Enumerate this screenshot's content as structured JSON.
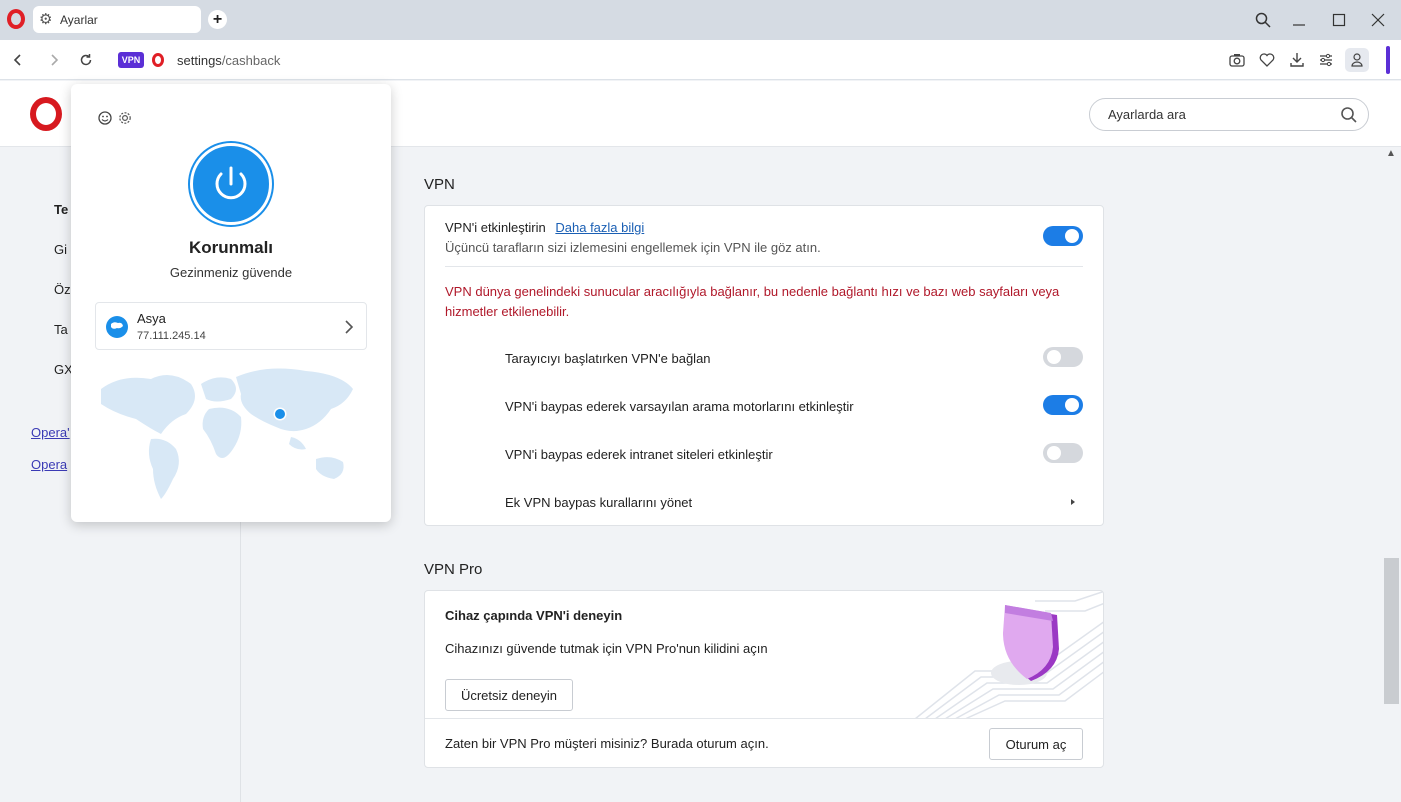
{
  "tab": {
    "title": "Ayarlar"
  },
  "address": {
    "vpn_badge": "VPN",
    "url_host": "settings",
    "url_path": "/cashback"
  },
  "search": {
    "placeholder": "Ayarlarda ara"
  },
  "leftnav": {
    "items": [
      "Te",
      "Gi",
      "Öz",
      "Ta",
      "GX"
    ],
    "links": [
      "Opera'",
      "Opera"
    ]
  },
  "vpn_section": {
    "title": "VPN",
    "enable_label": "VPN'i etkinleştirin",
    "learn_more": "Daha fazla bilgi",
    "enable_desc": "Üçüncü tarafların sizi izlemesini engellemek için VPN ile göz atın.",
    "enable_on": true,
    "warning": "VPN dünya genelindeki sunucular aracılığıyla bağlanır, bu nedenle bağlantı hızı ve bazı web sayfaları veya hizmetler etkilenebilir.",
    "options": [
      {
        "label": "Tarayıcıyı başlatırken VPN'e bağlan",
        "on": false
      },
      {
        "label": "VPN'i baypas ederek varsayılan arama motorlarını etkinleştir",
        "on": true
      },
      {
        "label": "VPN'i baypas ederek intranet siteleri etkinleştir",
        "on": false
      }
    ],
    "manage_rules": "Ek VPN baypas kurallarını yönet"
  },
  "vpn_pro": {
    "title": "VPN Pro",
    "card_title": "Cihaz çapında VPN'i deneyin",
    "card_desc": "Cihazınızı güvende tutmak için VPN Pro'nun kilidini açın",
    "try_button": "Ücretsiz deneyin",
    "existing_text": "Zaten bir VPN Pro müşteri misiniz? Burada oturum açın.",
    "login_button": "Oturum aç"
  },
  "popup": {
    "status_title": "Korunmalı",
    "status_sub": "Gezinmeniz güvende",
    "location_name": "Asya",
    "location_ip": "77.111.245.14"
  },
  "colors": {
    "accent": "#1c7de6",
    "vpn_purple": "#5b2fd6",
    "opera_red": "#e01f26",
    "warning": "#b0182a"
  }
}
